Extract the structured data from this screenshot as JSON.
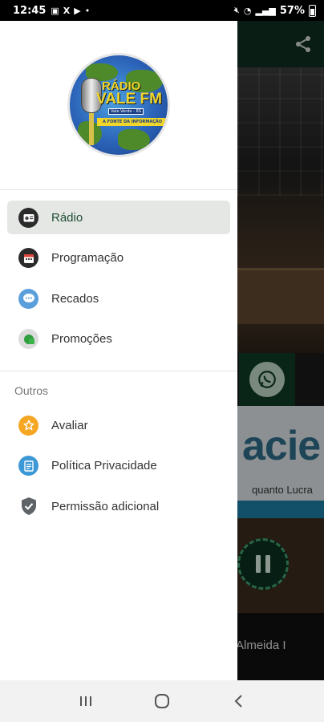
{
  "status_bar": {
    "time": "12:45",
    "battery": "57%",
    "icons": [
      "gallery-icon",
      "x-icon",
      "youtube-icon",
      "dot-icon",
      "mute-icon",
      "wifi-icon",
      "lte-signal-icon",
      "battery-icon"
    ]
  },
  "drawer": {
    "logo": {
      "line1": "RÁDIO",
      "line2": "VALE FM",
      "line3": "Vale Verde - RS",
      "ribbon": "A FONTE DA INFORMAÇÃO"
    },
    "menu": [
      {
        "label": "Rádio",
        "icon": "radio-icon",
        "active": true
      },
      {
        "label": "Programação",
        "icon": "calendar-icon",
        "active": false
      },
      {
        "label": "Recados",
        "icon": "chat-icon",
        "active": false
      },
      {
        "label": "Promoções",
        "icon": "gift-icon",
        "active": false
      }
    ],
    "section_title": "Outros",
    "others": [
      {
        "label": "Avaliar",
        "icon": "star-icon"
      },
      {
        "label": "Política Privacidade",
        "icon": "document-icon"
      },
      {
        "label": "Permissão adicional",
        "icon": "shield-icon"
      }
    ]
  },
  "background_app": {
    "banner_text": "acie",
    "banner_tag": "quanto Lucra",
    "artist_text": "Almeida I"
  },
  "colors": {
    "accent": "#1e4d34",
    "active_bg": "#e4e7e3",
    "toolbar": "#0f2d1f"
  }
}
